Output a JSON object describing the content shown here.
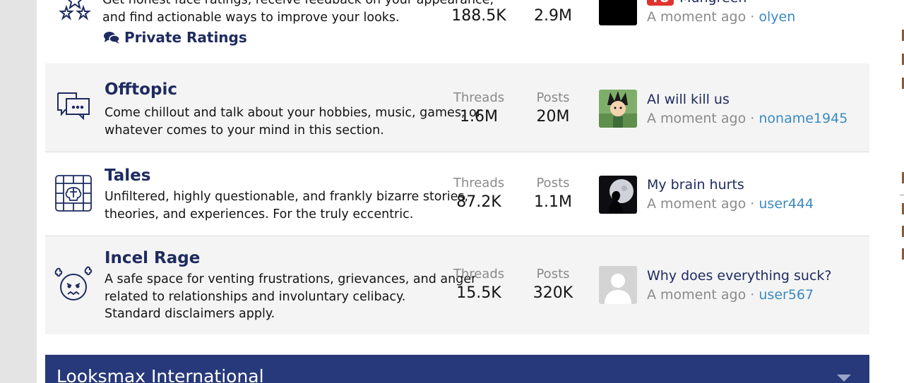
{
  "forums": {
    "looksmax_ratings": {
      "desc_lines": [
        "Get honest face ratings, receive feedback on your appearance,",
        "and find actionable ways to improve your looks."
      ],
      "subforum_label": "Private Ratings",
      "threads_value": "188.5K",
      "posts_value": "2.9M",
      "latest_badge_text": "TO",
      "latest_title": "Mungreen",
      "latest_time": "A moment ago",
      "latest_user": "olyen"
    },
    "offtopic": {
      "title": "Offtopic",
      "desc_lines": [
        "Come chillout and talk about your hobbies, music, games, or",
        "whatever comes to your mind in this section."
      ],
      "threads_label": "Threads",
      "threads_value": "1.6M",
      "posts_label": "Posts",
      "posts_value": "20M",
      "latest_title": "AI will kill us",
      "latest_time": "A moment ago",
      "latest_user": "noname1945"
    },
    "tales": {
      "title": "Tales",
      "desc_lines": [
        "Unfiltered, highly questionable, and frankly bizarre stories,",
        "theories, and experiences. For the truly eccentric."
      ],
      "threads_label": "Threads",
      "threads_value": "87.2K",
      "posts_label": "Posts",
      "posts_value": "1.1M",
      "latest_title": "My brain hurts",
      "latest_time": "A moment ago",
      "latest_user": "user444"
    },
    "incel_rage": {
      "title": "Incel Rage",
      "desc_lines": [
        "A safe space for venting frustrations, grievances, and anger",
        "related to relationships and involuntary celibacy.",
        "Standard disclaimers apply."
      ],
      "threads_label": "Threads",
      "threads_value": "15.5K",
      "posts_label": "Posts",
      "posts_value": "320K",
      "latest_title": "Why does everything suck?",
      "latest_time": "A moment ago",
      "latest_user": "user567"
    }
  },
  "separator": "·",
  "section_header": "Looksmax International",
  "icons": {
    "ratings": "stars-icon",
    "subforum": "comments-icon",
    "offtopic": "speech-bubbles-icon",
    "tales": "brain-box-icon",
    "incel_rage": "angry-face-icon",
    "collapse": "chevron-down-icon"
  },
  "colors": {
    "title": "#1e2b60",
    "user_link": "#3a8ac4",
    "header_bar": "#27397a",
    "badge": "#e0322e"
  }
}
